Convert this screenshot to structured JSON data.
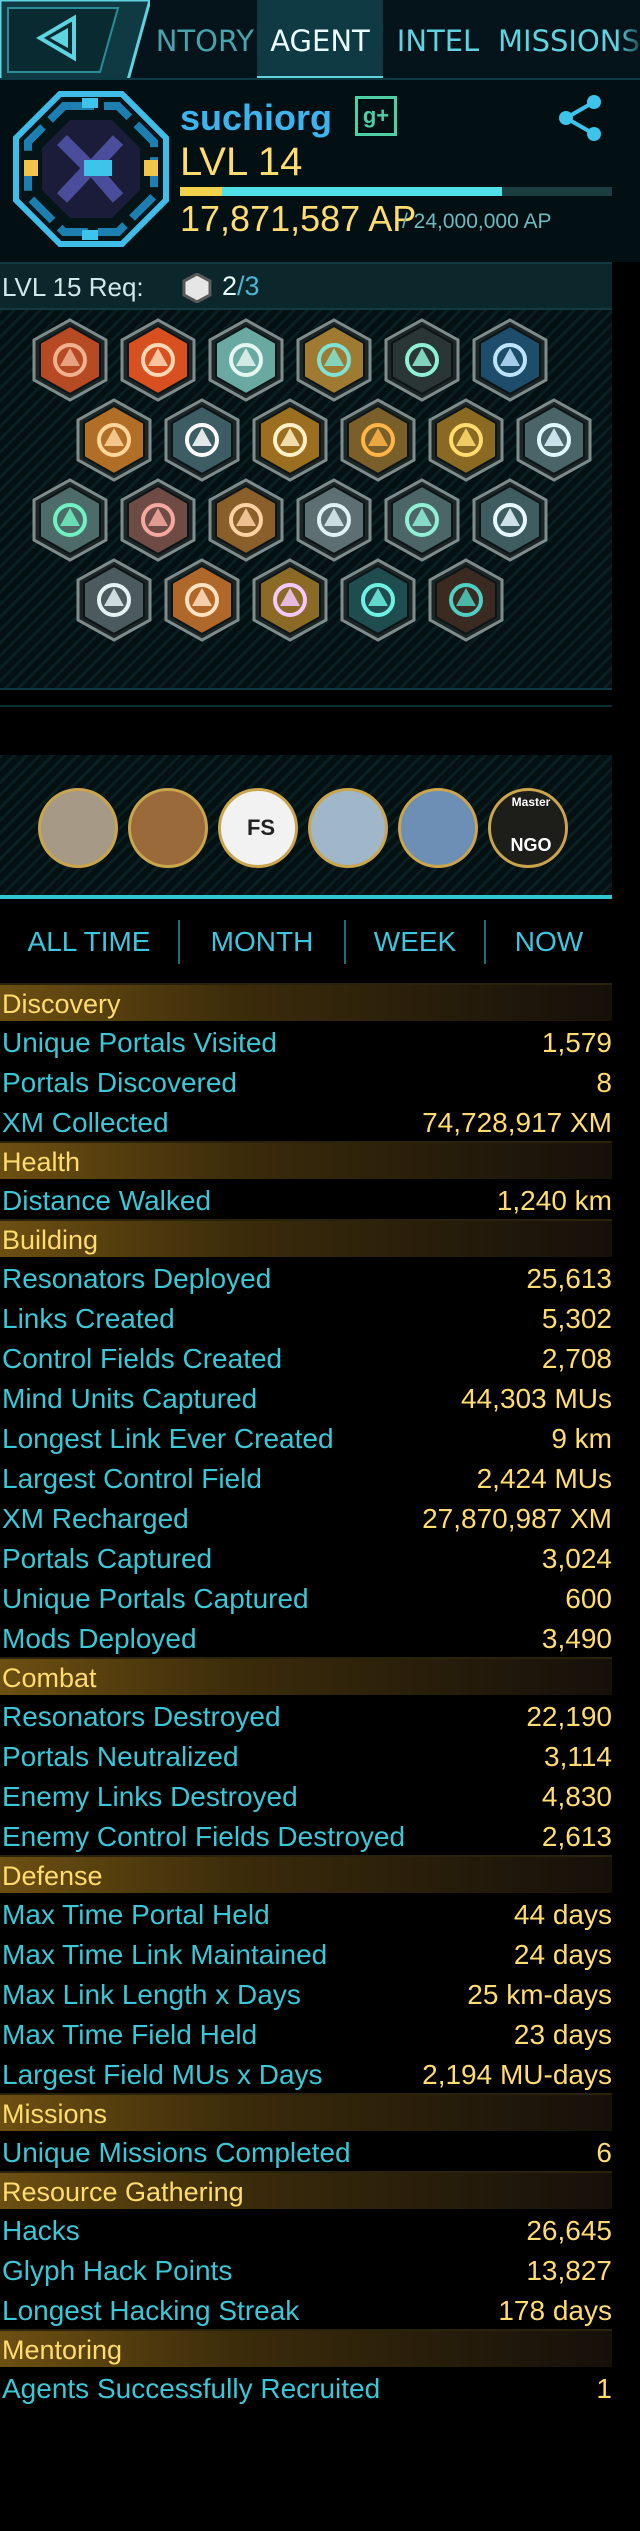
{
  "nav": {
    "tabs": [
      "NTORY",
      "AGENT",
      "INTEL",
      "MISSIONS"
    ],
    "active": "AGENT"
  },
  "profile": {
    "name": "suchiorg",
    "gplus_label": "g+",
    "level": "LVL 14",
    "ap": "17,871,587 AP",
    "ap_max": "/ 24,000,000 AP",
    "ap_progress": 0.745
  },
  "requirement": {
    "label": "LVL 15 Req:",
    "have": "2",
    "need": "/3"
  },
  "badges": [
    {
      "name": "badge-resistance-founder",
      "color": "#b54a24",
      "accent": "#f1b18f"
    },
    {
      "name": "badge-mind-controller",
      "color": "#d85020",
      "accent": "#ffd7b5"
    },
    {
      "name": "badge-recruiter",
      "color": "#6aa9a2",
      "accent": "#e3f7f0"
    },
    {
      "name": "badge-recharger",
      "color": "#9e7a33",
      "accent": "#7fe3d4"
    },
    {
      "name": "badge-innovator",
      "color": "#2a3536",
      "accent": "#8ff0d6"
    },
    {
      "name": "badge-sojourner",
      "color": "#1d4d6a",
      "accent": "#bde4ff"
    },
    {
      "name": "badge-builder",
      "color": "#b06e26",
      "accent": "#ffd59a"
    },
    {
      "name": "badge-trekker",
      "color": "#3d5c63",
      "accent": "#ffffff"
    },
    {
      "name": "badge-purifier",
      "color": "#9c6e1f",
      "accent": "#fff0c7"
    },
    {
      "name": "badge-engineer",
      "color": "#7a5f2a",
      "accent": "#ffb547"
    },
    {
      "name": "badge-connector",
      "color": "#8a6a23",
      "accent": "#ffdc70"
    },
    {
      "name": "badge-explorer",
      "color": "#4b6468",
      "accent": "#dff7ff"
    },
    {
      "name": "badge-seer",
      "color": "#4d6b68",
      "accent": "#6ff2c2"
    },
    {
      "name": "badge-hacker",
      "color": "#6e4b45",
      "accent": "#f4a8a0"
    },
    {
      "name": "badge-guardian",
      "color": "#8a5f2a",
      "accent": "#ffd1a3"
    },
    {
      "name": "badge-liberator",
      "color": "#5e6f74",
      "accent": "#dff1f4"
    },
    {
      "name": "badge-illuminator",
      "color": "#4c6668",
      "accent": "#8ff0d6"
    },
    {
      "name": "badge-pioneer",
      "color": "#3f5d60",
      "accent": "#e7f9ff"
    },
    {
      "name": "badge-specops",
      "color": "#4b5a5c",
      "accent": "#e5f2f2"
    },
    {
      "name": "badge-mission-day",
      "color": "#b0672a",
      "accent": "#ffe0c0"
    },
    {
      "name": "badge-translator",
      "color": "#8b6a25",
      "accent": "#f5c8ff"
    },
    {
      "name": "badge-verified",
      "color": "#1e4c4f",
      "accent": "#6ff0e2"
    },
    {
      "name": "badge-locked",
      "color": "#3a2a22",
      "accent": "#4fd0c2"
    }
  ],
  "medals": [
    {
      "name": "medal-shrine",
      "bg": "#a69a87"
    },
    {
      "name": "medal-samurai",
      "bg": "#9a6a3a"
    },
    {
      "name": "medal-fs",
      "bg": "#f2f2f2",
      "text": "FS"
    },
    {
      "name": "medal-waterfront",
      "bg": "#9fb7c8"
    },
    {
      "name": "medal-bridge",
      "bg": "#6d8fb5"
    },
    {
      "name": "medal-master-ngo",
      "bg": "#1d1d1a",
      "text": "Master",
      "text2": "NGO"
    }
  ],
  "time_tabs": [
    "ALL TIME",
    "MONTH",
    "WEEK",
    "NOW"
  ],
  "sections": [
    {
      "title": "Discovery",
      "rows": [
        {
          "label": "Unique Portals Visited",
          "value": "1,579"
        },
        {
          "label": "Portals Discovered",
          "value": "8"
        },
        {
          "label": "XM Collected",
          "value": "74,728,917 XM"
        }
      ]
    },
    {
      "title": "Health",
      "rows": [
        {
          "label": "Distance Walked",
          "value": "1,240 km"
        }
      ]
    },
    {
      "title": "Building",
      "rows": [
        {
          "label": "Resonators Deployed",
          "value": "25,613"
        },
        {
          "label": "Links Created",
          "value": "5,302"
        },
        {
          "label": "Control Fields Created",
          "value": "2,708"
        },
        {
          "label": "Mind Units Captured",
          "value": "44,303 MUs"
        },
        {
          "label": "Longest Link Ever Created",
          "value": "9 km"
        },
        {
          "label": "Largest Control Field",
          "value": "2,424 MUs"
        },
        {
          "label": "XM Recharged",
          "value": "27,870,987 XM"
        },
        {
          "label": "Portals Captured",
          "value": "3,024"
        },
        {
          "label": "Unique Portals Captured",
          "value": "600"
        },
        {
          "label": "Mods Deployed",
          "value": "3,490"
        }
      ]
    },
    {
      "title": "Combat",
      "rows": [
        {
          "label": "Resonators Destroyed",
          "value": "22,190"
        },
        {
          "label": "Portals Neutralized",
          "value": "3,114"
        },
        {
          "label": "Enemy Links Destroyed",
          "value": "4,830"
        },
        {
          "label": "Enemy Control Fields Destroyed",
          "value": "2,613"
        }
      ]
    },
    {
      "title": "Defense",
      "rows": [
        {
          "label": "Max Time Portal Held",
          "value": "44 days"
        },
        {
          "label": "Max Time Link Maintained",
          "value": "24 days"
        },
        {
          "label": "Max Link Length x Days",
          "value": "25 km-days"
        },
        {
          "label": "Max Time Field Held",
          "value": "23 days"
        },
        {
          "label": "Largest Field MUs x Days",
          "value": "2,194 MU-days"
        }
      ]
    },
    {
      "title": "Missions",
      "rows": [
        {
          "label": "Unique Missions Completed",
          "value": "6"
        }
      ]
    },
    {
      "title": "Resource Gathering",
      "rows": [
        {
          "label": "Hacks",
          "value": "26,645"
        },
        {
          "label": "Glyph Hack Points",
          "value": "13,827"
        },
        {
          "label": "Longest Hacking Streak",
          "value": "178 days"
        }
      ]
    },
    {
      "title": "Mentoring",
      "rows": [
        {
          "label": "Agents Successfully Recruited",
          "value": "1"
        }
      ]
    }
  ]
}
